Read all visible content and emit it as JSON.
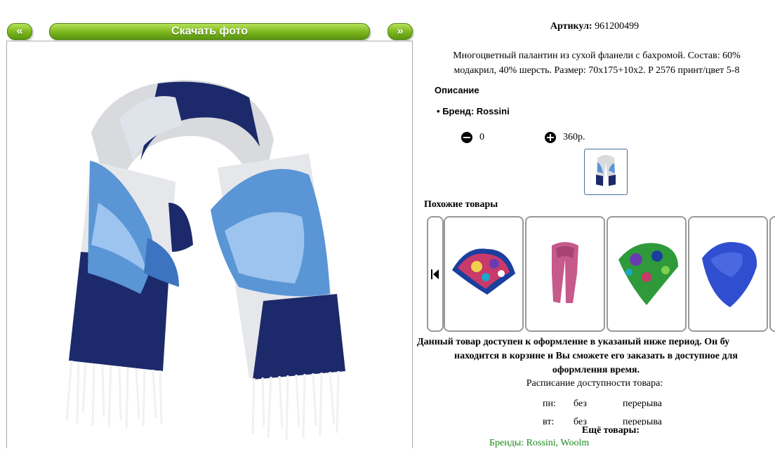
{
  "nav": {
    "prev_label": "«",
    "download_label": "Скачать фото",
    "next_label": "»"
  },
  "product": {
    "article_label": "Артикул:",
    "article_value": "961200499",
    "description_line1": "Многоцветный палантин из сухой фланели с бахромой. Состав: 60%",
    "description_line2": "модакрил, 40% шерсть. Размер: 70х175+10х2. P 2576 принт/цвет 5-8",
    "description_title": "Описание",
    "brand": "Бренд: Rossini",
    "quantity": "0",
    "price": "360р."
  },
  "similar": {
    "title": "Похожие товары",
    "items": [
      {
        "name": "scarf-multicolor-square"
      },
      {
        "name": "scarf-pink"
      },
      {
        "name": "scarf-green-floral"
      },
      {
        "name": "scarf-blue"
      }
    ]
  },
  "availability": {
    "notice_line1": "Данный товар доступен к оформление в указаный ниже период. Он бу",
    "notice_line2": "находится в корзине и Вы сможете его заказать в доступное для",
    "notice_line3": "оформления время.",
    "schedule_title": "Расписание доступности товара:",
    "rows": [
      {
        "day": "пн:",
        "from": "без",
        "to": "перерыва"
      },
      {
        "day": "вт:",
        "from": "без",
        "to": "перерыва"
      }
    ]
  },
  "more": {
    "title": "Ещё товары:",
    "link": "Бренды: Rossini, Woolm"
  },
  "colors": {
    "accent_green": "#7ab51c",
    "link_green": "#1b8a1b",
    "thumb_border": "#4a6d9a"
  }
}
